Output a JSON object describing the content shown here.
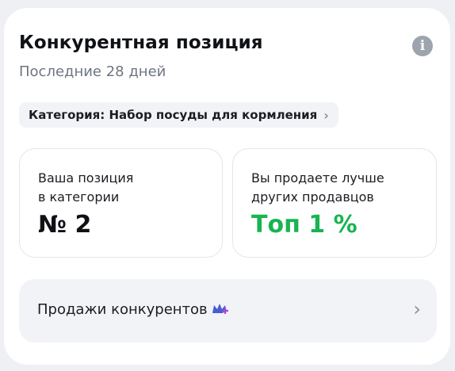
{
  "header": {
    "title": "Конкурентная позиция",
    "subtitle": "Последние 28 дней",
    "info_icon": "info-icon"
  },
  "category": {
    "label": "Категория: Набор посуды для кормления",
    "chevron": "›"
  },
  "stats": [
    {
      "label_line1": "Ваша позиция",
      "label_line2": "в категории",
      "value": "№ 2",
      "color": "#0f1115"
    },
    {
      "label_line1": "Вы продаете лучше",
      "label_line2": "других продавцов",
      "value": "Топ 1 %",
      "color": "#18b451"
    }
  ],
  "competitor_sales": {
    "label": "Продажи конкурентов",
    "icon": "premium-crown-icon",
    "chevron": "›"
  }
}
